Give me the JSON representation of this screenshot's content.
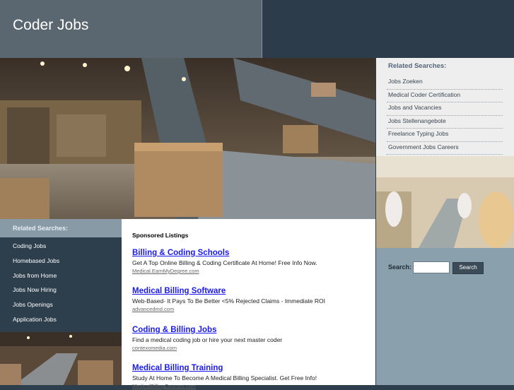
{
  "header": {
    "title": "Coder Jobs"
  },
  "related_right": {
    "title": "Related Searches:",
    "items": [
      "Jobs Zoeken",
      "Medical Coder Certification",
      "Jobs and Vacancies",
      "Jobs Stellenangebote",
      "Freelance Typing Jobs",
      "Government Jobs Careers"
    ]
  },
  "related_left": {
    "title": "Related Searches:",
    "items": [
      "Coding Jobs",
      "Homebased Jobs",
      "Jobs from Home",
      "Jobs Now Hiring",
      "Jobs Openings",
      "Application Jobs"
    ]
  },
  "search": {
    "label": "Search:",
    "button": "Search",
    "value": ""
  },
  "content": {
    "sponsored": "Sponsored Listings",
    "ads": [
      {
        "title": "Billing & Coding Schools",
        "desc": "Get A Top Online Billing & Coding Certificate At Home! Free Info Now.",
        "url": "Medical.EarnMyDegree.com"
      },
      {
        "title": "Medical Billing Software",
        "desc": "Web-Based- It Pays To Be Better <5% Rejected Claims - Immediate ROI",
        "url": "advancedmd.com"
      },
      {
        "title": "Coding & Billing Jobs",
        "desc": "Find a medical coding job or hire your next master coder",
        "url": "contexomedia.com"
      },
      {
        "title": "Medical Billing Training",
        "desc": "Study At Home To Become A Medical Billing Specialist. Get Free Info!",
        "url": "MedicalBillingCourses.com"
      }
    ]
  }
}
